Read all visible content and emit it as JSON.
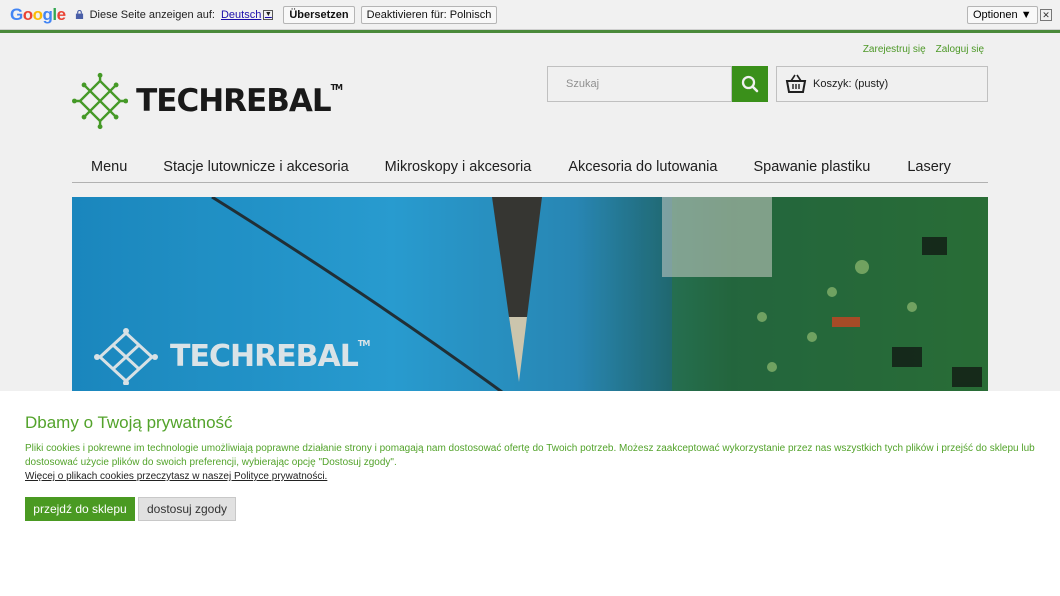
{
  "translate_bar": {
    "logo": "Google",
    "logo_colors": [
      "#4285f4",
      "#ea4335",
      "#fbbc05",
      "#4285f4",
      "#34a853",
      "#ea4335"
    ],
    "prompt": "Diese Seite anzeigen auf:",
    "language": "Deutsch",
    "translate_button": "Übersetzen",
    "deactivate_button": "Deaktivieren für: Polnisch",
    "options_button": "Optionen ▼",
    "close_symbol": "✕"
  },
  "header": {
    "register_link": "Zarejestruj się",
    "login_link": "Zaloguj się",
    "logo_text": "TECHREBAL",
    "logo_tm": "TM",
    "search_placeholder": "Szukaj",
    "cart_label": "Koszyk: (pusty)",
    "accent_color": "#3e9a1c"
  },
  "nav": {
    "items": [
      "Menu",
      "Stacje lutownicze i akcesoria",
      "Mikroskopy i akcesoria",
      "Akcesoria do lutowania",
      "Spawanie plastiku",
      "Lasery"
    ]
  },
  "banner": {
    "logo_text": "TECHREBAL",
    "logo_tm": "TM"
  },
  "cookie": {
    "title": "Dbamy o Twoją prywatność",
    "text": "Pliki cookies i pokrewne im technologie umożliwiają poprawne działanie strony i pomagają nam dostosować ofertę do Twoich potrzeb. Możesz zaakceptować wykorzystanie przez nas wszystkich tych plików i przejść do sklepu lub dostosować użycie plików do swoich preferencji, wybierając opcję \"Dostosuj zgody\".",
    "policy_link": "Więcej o plikach cookies przeczytasz w naszej Polityce prywatności.",
    "accept_button": "przejdź do sklepu",
    "customize_button": "dostosuj zgody"
  }
}
